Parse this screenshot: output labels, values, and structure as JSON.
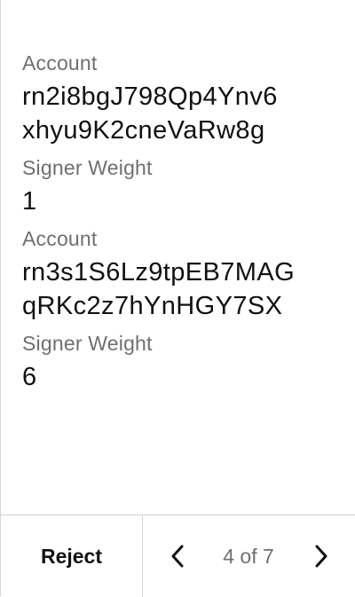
{
  "signers": [
    {
      "account_label": "Account",
      "account_line1": "rn2i8bgJ798Qp4Ynv6",
      "account_line2": "xhyu9K2cneVaRw8g",
      "weight_label": "Signer Weight",
      "weight_value": "1"
    },
    {
      "account_label": "Account",
      "account_line1": "rn3s1S6Lz9tpEB7MAG",
      "account_line2": "qRKc2z7hYnHGY7SX",
      "weight_label": "Signer Weight",
      "weight_value": "6"
    }
  ],
  "footer": {
    "reject_label": "Reject",
    "pager_text": "4 of 7",
    "prev_icon": "chevron-left-icon",
    "next_icon": "chevron-right-icon"
  },
  "colors": {
    "text": "#111111",
    "label": "#6f6f6f",
    "divider": "#d6d6d6"
  }
}
